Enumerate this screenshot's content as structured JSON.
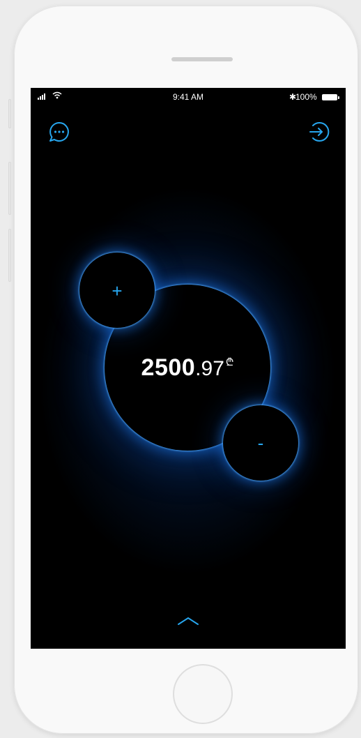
{
  "status_bar": {
    "time": "9:41 AM",
    "bluetooth": "✱",
    "battery_percent": "100%"
  },
  "top_bar": {
    "left_icon": "chat-bubble-icon",
    "right_icon": "logout-arrow-icon"
  },
  "balance": {
    "integer": "2500",
    "decimal": ".97",
    "currency_symbol": "₾"
  },
  "controls": {
    "increase_label": "+",
    "decrease_label": "-"
  },
  "bottom": {
    "icon": "chevron-up-icon"
  },
  "colors": {
    "accent": "#27a6ee",
    "glow": "#1e78e6",
    "screen_bg": "#000000",
    "phone_body": "#f9f9f9"
  }
}
